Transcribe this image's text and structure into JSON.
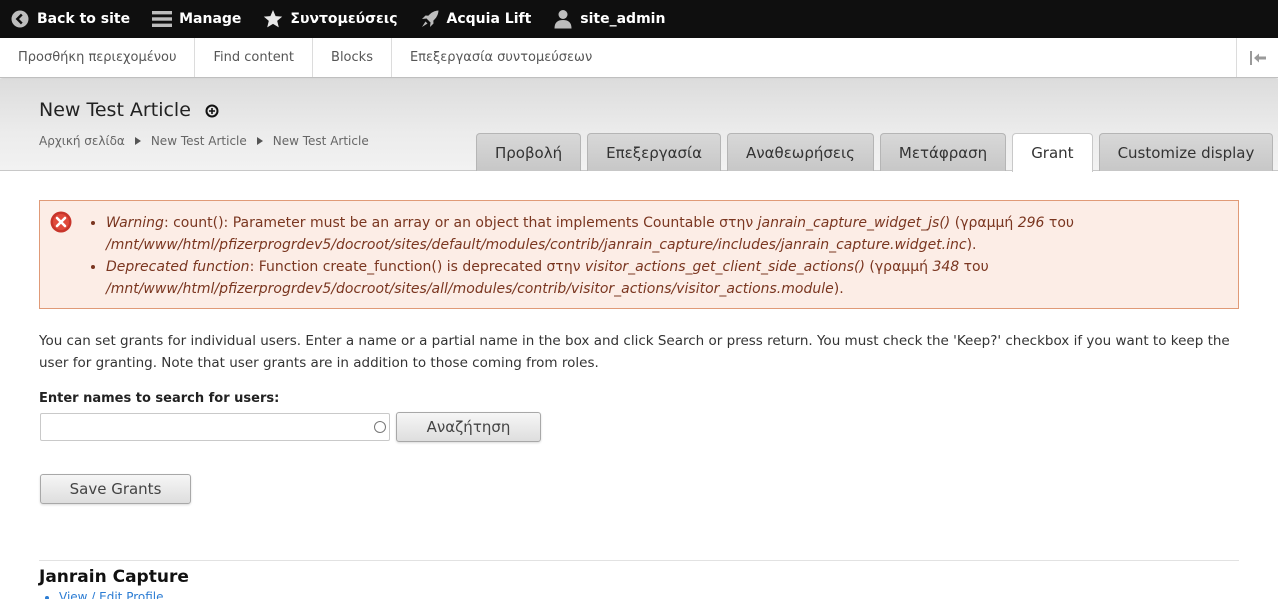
{
  "toolbar": {
    "back_label": "Back to site",
    "manage_label": "Manage",
    "shortcuts_label": "Συντομεύσεις",
    "lift_label": "Acquia Lift",
    "user_label": "site_admin"
  },
  "tray": {
    "items": [
      "Προσθήκη περιεχομένου",
      "Find content",
      "Blocks",
      "Επεξεργασία συντομεύσεων"
    ]
  },
  "header": {
    "title": "New Test Article",
    "breadcrumb": [
      "Αρχική σελίδα",
      "New Test Article",
      "New Test Article"
    ]
  },
  "tabs": [
    {
      "label": "Προβολή",
      "active": false
    },
    {
      "label": "Επεξεργασία",
      "active": false
    },
    {
      "label": "Αναθεωρήσεις",
      "active": false
    },
    {
      "label": "Μετάφραση",
      "active": false
    },
    {
      "label": "Grant",
      "active": true
    },
    {
      "label": "Customize display",
      "active": false
    }
  ],
  "messages": [
    {
      "type": "Warning",
      "text1": ": count(): Parameter must be an array or an object that implements Countable στην ",
      "func": "janrain_capture_widget_js()",
      "text2": " (γραμμή ",
      "line": "296",
      "text3": " του ",
      "path": "/mnt/www/html/pfizerprogrdev5/docroot/sites/default/modules/contrib/janrain_capture/includes/janrain_capture.widget.inc",
      "end": ")."
    },
    {
      "type": "Deprecated function",
      "text1": ": Function create_function() is deprecated στην ",
      "func": "visitor_actions_get_client_side_actions()",
      "text2": " (γραμμή ",
      "line": "348",
      "text3": " του ",
      "path": "/mnt/www/html/pfizerprogrdev5/docroot/sites/all/modules/contrib/visitor_actions/visitor_actions.module",
      "end": ")."
    }
  ],
  "intro": "You can set grants for individual users. Enter a name or a partial name in the box and click Search or press return. You must check the 'Keep?' checkbox if you want to keep the user for granting. Note that user grants are in addition to those coming from roles.",
  "search": {
    "label": "Enter names to search for users:",
    "value": "",
    "button": "Αναζήτηση"
  },
  "save_button": "Save Grants",
  "block": {
    "title": "Janrain Capture",
    "links": [
      "View / Edit Profile"
    ]
  },
  "colors": {
    "toolbar_bg": "#0f0f0f",
    "error_bg": "#fcede6",
    "error_border": "#e09a77",
    "link": "#2b7cd3"
  }
}
